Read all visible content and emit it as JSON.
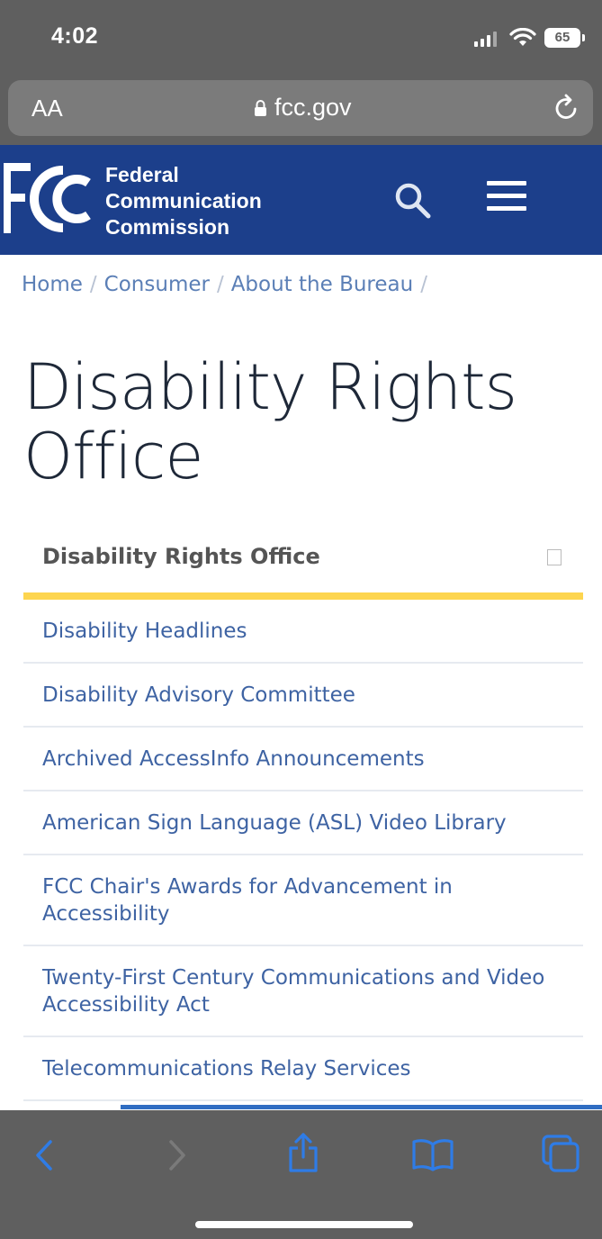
{
  "status_bar": {
    "time": "4:02",
    "battery": "65"
  },
  "browser": {
    "text_size_label": "AA",
    "url": "fcc.gov",
    "icons": [
      "lock-icon",
      "reload-icon"
    ]
  },
  "site_header": {
    "logo_alt": "FCC",
    "name_line1": "Federal",
    "name_line2": "Communication",
    "name_line3": "Commission",
    "brand_color": "#1c3f8b",
    "icons": [
      "search-icon",
      "menu-icon"
    ]
  },
  "breadcrumb": {
    "items": [
      "Home",
      "Consumer",
      "About the Bureau"
    ],
    "separator": "/"
  },
  "page": {
    "title_line1": "Disability Rights",
    "title_line2": "Office"
  },
  "side_nav": {
    "heading": "Disability Rights Office",
    "accent_color": "#fdd54f",
    "items": [
      "Disability Headlines",
      "Disability Advisory Committee",
      "Archived AccessInfo Announcements",
      "American Sign Language (ASL) Video Library",
      "FCC Chair's Awards for Advancement in Accessibility",
      "Twenty-First Century Communications and Video Accessibility Act",
      "Telecommunications Relay Services"
    ]
  },
  "toolbar": {
    "icons": [
      "back-icon",
      "forward-icon",
      "share-icon",
      "bookmarks-icon",
      "tabs-icon"
    ],
    "accent_color": "#2f6dc2"
  }
}
